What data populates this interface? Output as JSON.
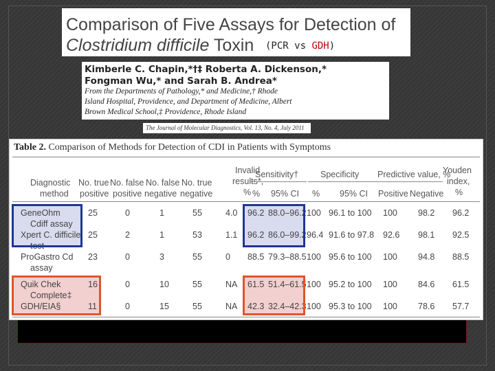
{
  "title": {
    "line1": "Comparison of Five Assays for Detection of",
    "line2_italic": "Clostridium difficile",
    "line2_rest": " Toxin",
    "subtitle_prefix": "(PCR vs ",
    "subtitle_red": "GDH",
    "subtitle_suffix": ")"
  },
  "authors": {
    "line1": "Kimberle C. Chapin,*†‡ Roberta A. Dickenson,*",
    "line2": "Fongman Wu,* and Sarah B. Andrea*",
    "aff1": "From the Departments of Pathology,* and Medicine,† Rhode",
    "aff2": "Island Hospital, Providence, and Department of Medicine, Albert",
    "aff3": "Brown Medical School,‡ Providence, Rhode Island"
  },
  "journal": "The Journal of Molecular Diagnostics, Vol. 13, No. 4, July 2011",
  "table": {
    "caption_label": "Table 2.",
    "caption_text": "  Comparison of Methods for Detection of CDI in Patients with Symptoms",
    "group_headers": {
      "invalid": [
        "Invalid",
        "results*,",
        "%"
      ],
      "sensitivity": "Sensitivity†",
      "specificity": "Specificity",
      "predictive": "Predictive value, %",
      "youden": [
        "Youden",
        "index,",
        "%"
      ]
    },
    "col_headers": {
      "method": [
        "Diagnostic",
        "method"
      ],
      "true_pos": [
        "No. true",
        "positive"
      ],
      "false_pos": [
        "No. false",
        "positive"
      ],
      "false_neg": [
        "No. false",
        "negative"
      ],
      "true_neg": [
        "No. true",
        "negative"
      ],
      "sens_pct": "%",
      "sens_ci": "95% CI",
      "spec_pct": "%",
      "spec_ci": "95% CI",
      "ppv": "Positive",
      "npv": "Negative"
    },
    "rows": [
      {
        "method": [
          "GeneOhm",
          "Cdiff assay"
        ],
        "tp": "25",
        "fp": "0",
        "fn": "1",
        "tn": "55",
        "invalid": "4.0",
        "sens": "96.2",
        "sens_ci": "88.0–96.2",
        "spec": "100",
        "spec_ci": "96.1 to 100",
        "ppv": "100",
        "npv": "98.2",
        "youden": "96.2"
      },
      {
        "method": [
          "Xpert C. difficile",
          "test"
        ],
        "tp": "25",
        "fp": "2",
        "fn": "1",
        "tn": "53",
        "invalid": "1.1",
        "sens": "96.2",
        "sens_ci": "86.0–99.2",
        "spec": "96.4",
        "spec_ci": "91.6 to 97.8",
        "ppv": "92.6",
        "npv": "98.1",
        "youden": "92.5"
      },
      {
        "method": [
          "ProGastro Cd",
          "assay"
        ],
        "tp": "23",
        "fp": "0",
        "fn": "3",
        "tn": "55",
        "invalid": "0",
        "sens": "88.5",
        "sens_ci": "79.3–88.5",
        "spec": "100",
        "spec_ci": "95.6 to 100",
        "ppv": "100",
        "npv": "94.8",
        "youden": "88.5"
      },
      {
        "method": [
          "Quik Chek",
          "Complete‡"
        ],
        "tp": "16",
        "fp": "0",
        "fn": "10",
        "tn": "55",
        "invalid": "NA",
        "sens": "61.5",
        "sens_ci": "51.4–61.5",
        "spec": "100",
        "spec_ci": "95.2 to 100",
        "ppv": "100",
        "npv": "84.6",
        "youden": "61.5"
      },
      {
        "method": [
          "GDH/EIA§",
          ""
        ],
        "tp": "11",
        "fp": "0",
        "fn": "15",
        "tn": "55",
        "invalid": "NA",
        "sens": "42.3",
        "sens_ci": "32.4–42.3",
        "spec": "100",
        "spec_ci": "95.3 to 100",
        "ppv": "100",
        "npv": "78.6",
        "youden": "57.7"
      }
    ]
  },
  "colors": {
    "pcr_highlight_border": "#1f3596",
    "pcr_highlight_fill": "#d9dbee",
    "gdh_highlight_border": "#e0542c",
    "gdh_highlight_fill": "#f1d0cf",
    "subtitle_accent": "#c00000"
  }
}
